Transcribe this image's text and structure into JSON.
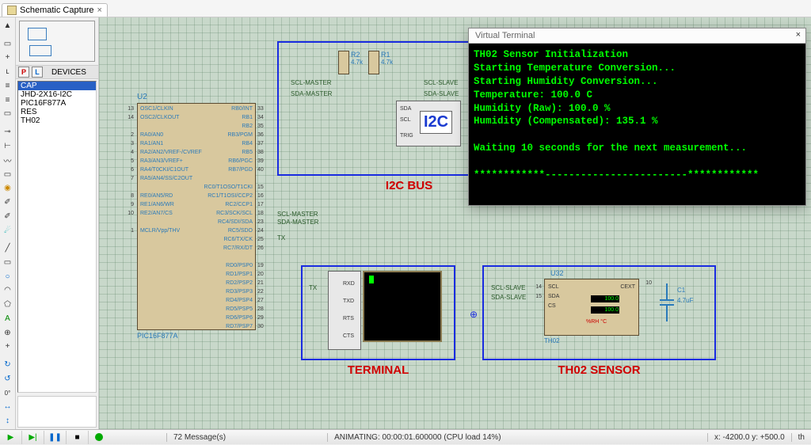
{
  "tabs": {
    "active": "Schematic Capture"
  },
  "device_panel": {
    "label": "DEVICES",
    "items": [
      "CAP",
      "JHD-2X16-I2C",
      "PIC16F877A",
      "RES",
      "TH02"
    ],
    "selected": 0
  },
  "chip": {
    "ref": "U2",
    "part": "PIC16F877A",
    "left_pins": [
      {
        "num": "13",
        "name": "OSC1/CLKIN"
      },
      {
        "num": "14",
        "name": "OSC2/CLKOUT"
      },
      {
        "num": "",
        "name": ""
      },
      {
        "num": "2",
        "name": "RA0/AN0"
      },
      {
        "num": "3",
        "name": "RA1/AN1"
      },
      {
        "num": "4",
        "name": "RA2/AN2/VREF-/CVREF"
      },
      {
        "num": "5",
        "name": "RA3/AN3/VREF+"
      },
      {
        "num": "6",
        "name": "RA4/T0CKI/C1OUT"
      },
      {
        "num": "7",
        "name": "RA5/AN4/SS/C2OUT"
      },
      {
        "num": "",
        "name": ""
      },
      {
        "num": "8",
        "name": "RE0/AN5/RD"
      },
      {
        "num": "9",
        "name": "RE1/AN6/WR"
      },
      {
        "num": "10",
        "name": "RE2/AN7/CS"
      },
      {
        "num": "",
        "name": ""
      },
      {
        "num": "1",
        "name": "MCLR/Vpp/THV"
      }
    ],
    "right_pins": [
      {
        "num": "33",
        "name": "RB0/INT"
      },
      {
        "num": "34",
        "name": "RB1"
      },
      {
        "num": "35",
        "name": "RB2"
      },
      {
        "num": "36",
        "name": "RB3/PGM"
      },
      {
        "num": "37",
        "name": "RB4"
      },
      {
        "num": "38",
        "name": "RB5"
      },
      {
        "num": "39",
        "name": "RB6/PGC"
      },
      {
        "num": "40",
        "name": "RB7/PGD"
      },
      {
        "num": "",
        "name": ""
      },
      {
        "num": "15",
        "name": "RC0/T1OSO/T1CKI"
      },
      {
        "num": "16",
        "name": "RC1/T1OSI/CCP2"
      },
      {
        "num": "17",
        "name": "RC2/CCP1"
      },
      {
        "num": "18",
        "name": "RC3/SCK/SCL"
      },
      {
        "num": "23",
        "name": "RC4/SDI/SDA"
      },
      {
        "num": "24",
        "name": "RC5/SDO"
      },
      {
        "num": "25",
        "name": "RC6/TX/CK"
      },
      {
        "num": "26",
        "name": "RC7/RX/DT"
      },
      {
        "num": "",
        "name": ""
      },
      {
        "num": "19",
        "name": "RD0/PSP0"
      },
      {
        "num": "20",
        "name": "RD1/PSP1"
      },
      {
        "num": "21",
        "name": "RD2/PSP2"
      },
      {
        "num": "22",
        "name": "RD3/PSP3"
      },
      {
        "num": "27",
        "name": "RD4/PSP4"
      },
      {
        "num": "28",
        "name": "RD5/PSP5"
      },
      {
        "num": "29",
        "name": "RD6/PSP6"
      },
      {
        "num": "30",
        "name": "RD7/PSP7"
      }
    ]
  },
  "chip_labels": {
    "scl_master": "SCL-MASTER",
    "sda_master": "SDA-MASTER",
    "tx": "TX",
    "scl_slave": "SCL-SLAVE",
    "sda_slave": "SDA-SLAVE"
  },
  "i2c_bus": {
    "label": "I2C BUS",
    "r1": "R1",
    "r2": "R2",
    "rval": "4.7k",
    "logo": "I2C",
    "pins": {
      "sda": "SDA",
      "scl": "SCL",
      "trig": "TRIG"
    }
  },
  "terminal_box": {
    "label": "TERMINAL",
    "tx": "TX",
    "pins": [
      "RXD",
      "TXD",
      "RTS",
      "CTS"
    ]
  },
  "th02": {
    "label": "TH02 SENSOR",
    "ref": "U32",
    "part": "TH02",
    "pins": {
      "scl": "SCL",
      "sda": "SDA",
      "cs": "CS",
      "cext": "CEXT"
    },
    "net": {
      "scl_slave_num": "14",
      "sda_slave_num": "15",
      "cext_num": "10"
    },
    "temp": "100.0",
    "hum": "100.0",
    "units": "%RH   °C",
    "cap_ref": "C1",
    "cap_val": "4.7uF"
  },
  "virtual_terminal": {
    "title": "Virtual Terminal",
    "lines": [
      "TH02 Sensor Initialization",
      "Starting Temperature Conversion...",
      "Starting Humidity Conversion...",
      "Temperature: 100.0 C",
      "Humidity (Raw): 100.0 %",
      "Humidity (Compensated): 135.1 %",
      "",
      "Waiting 10 seconds for the next measurement...",
      "",
      "************------------------------************"
    ]
  },
  "status": {
    "messages": "72 Message(s)",
    "animating": "ANIMATING: 00:00:01.600000 (CPU load 14%)",
    "coords": "x: -4200.0  y: +500.0",
    "unit": "th"
  },
  "rotation": "0°"
}
